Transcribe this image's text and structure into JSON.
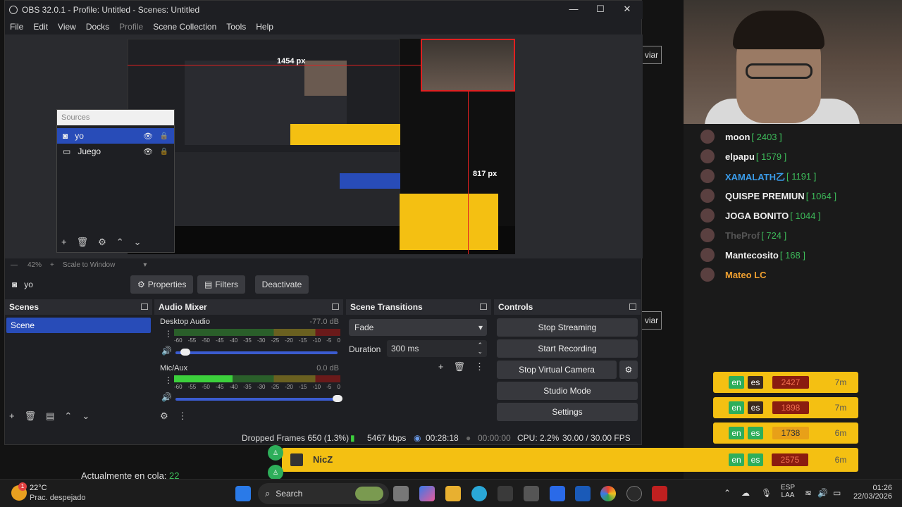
{
  "window": {
    "title": "OBS 32.0.1 - Profile: Untitled - Scenes: Untitled"
  },
  "menu": [
    "File",
    "Edit",
    "View",
    "Docks",
    "Profile",
    "Scene Collection",
    "Tools",
    "Help"
  ],
  "preview": {
    "width_label": "1454 px",
    "height_label": "817 px",
    "zoom": "42%",
    "scale_mode": "Scale to Window"
  },
  "sources_panel": {
    "title": "Sources",
    "items": [
      {
        "name": "yo",
        "icon": "camera-icon"
      },
      {
        "name": "Juego",
        "icon": "monitor-icon"
      }
    ]
  },
  "source_toolbar": {
    "selected": "yo",
    "properties": "Properties",
    "filters": "Filters",
    "deactivate": "Deactivate"
  },
  "scenes": {
    "title": "Scenes",
    "items": [
      "Scene"
    ]
  },
  "audio_mixer": {
    "title": "Audio Mixer",
    "channels": [
      {
        "name": "Desktop Audio",
        "level": "-77.0 dB",
        "volume": 0.06,
        "meter": 0.0
      },
      {
        "name": "Mic/Aux",
        "level": "0.0 dB",
        "volume": 1.0,
        "meter": 0.35
      }
    ],
    "scale": [
      "-60",
      "-55",
      "-50",
      "-45",
      "-40",
      "-35",
      "-30",
      "-25",
      "-20",
      "-15",
      "-10",
      "-5",
      "0"
    ]
  },
  "transitions": {
    "title": "Scene Transitions",
    "selected": "Fade",
    "duration_label": "Duration",
    "duration": "300 ms"
  },
  "controls": {
    "title": "Controls",
    "stop_streaming": "Stop Streaming",
    "start_recording": "Start Recording",
    "stop_virtual_camera": "Stop Virtual Camera",
    "studio_mode": "Studio Mode",
    "settings": "Settings"
  },
  "status": {
    "dropped_frames": "Dropped Frames 650 (1.3%)",
    "bitrate": "5467 kbps",
    "stream_time": "00:28:18",
    "record_time": "00:00:00",
    "cpu": "CPU: 2.2%",
    "fps": "30.00 / 30.00 FPS"
  },
  "leaderboard": [
    {
      "name": "moon",
      "score": "[ 2403 ]"
    },
    {
      "name": "elpapu",
      "score": "[ 1579 ]"
    },
    {
      "name": "XAMALATH⼄",
      "score": "[ 1191 ]",
      "color": "#3a9be8"
    },
    {
      "name": "QUISPE PREMIUN",
      "score": "[ 1064 ]"
    },
    {
      "name": "JOGA BONITO",
      "score": "[ 1044 ]"
    },
    {
      "name": "TheProf",
      "score": "[ 724 ]",
      "color": "#555555"
    },
    {
      "name": "Mantecosito",
      "score": "[ 168 ]"
    },
    {
      "name": "Mateo LC",
      "score": "",
      "color": "#f0a030"
    }
  ],
  "queue": [
    {
      "en": "en",
      "es": "es",
      "score": "2427",
      "time": "7m"
    },
    {
      "en": "en",
      "es": "es",
      "score": "1898",
      "time": "7m"
    },
    {
      "en": "en",
      "es": "es",
      "score": "1738",
      "time": "6m"
    },
    {
      "en": "en",
      "es": "es",
      "score": "2575",
      "time": "6m"
    }
  ],
  "queue_name": "NicZ",
  "queue_label": "Actualmente en cola:",
  "queue_count": "22",
  "side_button_1": "viar",
  "side_button_2": "viar",
  "taskbar": {
    "weather_temp": "22°C",
    "weather_desc": "Prac. despejado",
    "weather_badge": "1",
    "search": "Search",
    "lang": "ESP",
    "layout": "LAA",
    "time": "01:26",
    "date": "22/03/2026"
  },
  "colors": {
    "accent": "#284cb8",
    "queue_yellow": "#f4c012",
    "en_green": "#2eae5a"
  }
}
